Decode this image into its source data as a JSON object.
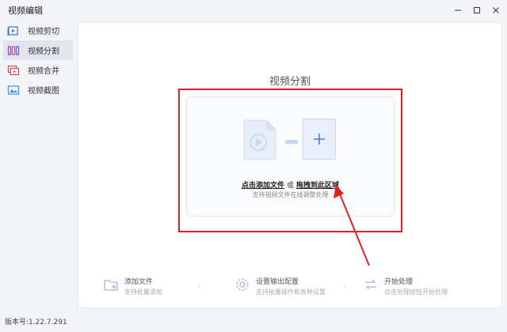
{
  "app": {
    "title": "视频编辑",
    "version": "版本号:1.22.7.291"
  },
  "window_controls": {
    "minimize": "—",
    "maximize": "☐",
    "close": "✕"
  },
  "sidebar": {
    "items": [
      {
        "label": "视频剪切",
        "icon": "video-cut-icon",
        "active": false
      },
      {
        "label": "视频分割",
        "icon": "video-split-icon",
        "active": true
      },
      {
        "label": "视频合并",
        "icon": "video-merge-icon",
        "active": false
      },
      {
        "label": "视频截图",
        "icon": "video-screenshot-icon",
        "active": false
      }
    ]
  },
  "main": {
    "title": "视频分割",
    "drop": {
      "add_file_link": "点击添加文件",
      "or": "或",
      "drag_link": "拖拽到此区域",
      "subtitle": "支持视频文件在线调整处理"
    }
  },
  "steps": [
    {
      "title": "添加文件",
      "desc": "支持批量添加",
      "icon": "add-file-icon"
    },
    {
      "title": "设置输出配置",
      "desc": "支持批量操作和各种设置",
      "icon": "settings-icon"
    },
    {
      "title": "开始处理",
      "desc": "点击处理按钮开始处理",
      "icon": "process-icon"
    }
  ],
  "colors": {
    "highlight_box": "#e02020",
    "accent_blue": "#3b6fd8",
    "sidebar_active": "#e2e5ee"
  }
}
